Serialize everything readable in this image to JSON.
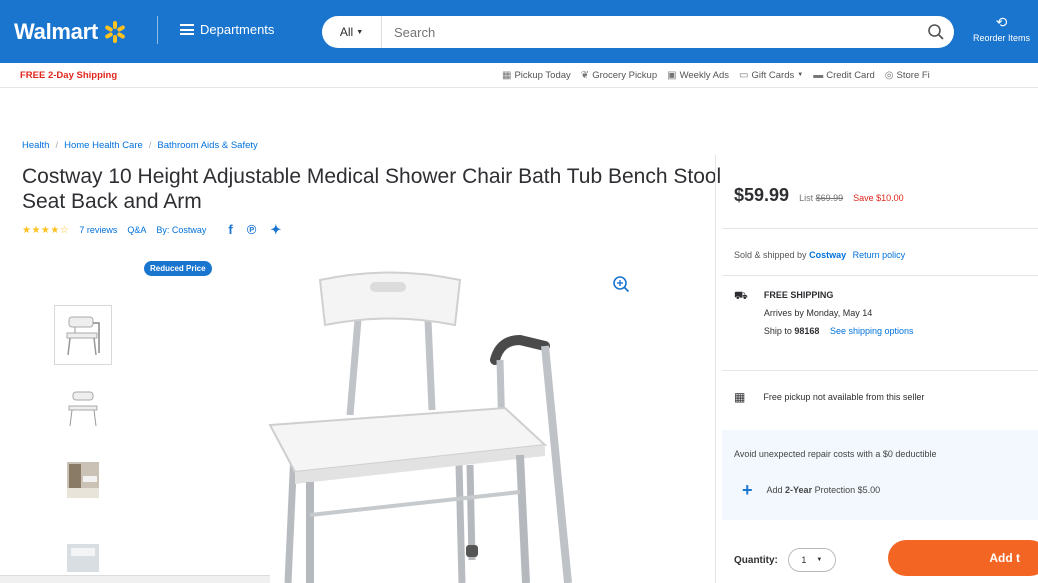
{
  "header": {
    "logo_text": "Walmart",
    "departments_label": "Departments",
    "search_category": "All",
    "search_placeholder": "Search",
    "reorder_label": "Reorder Items"
  },
  "subheader": {
    "free_shipping": "FREE 2-Day Shipping",
    "links": [
      "Pickup Today",
      "Grocery Pickup",
      "Weekly Ads",
      "Gift Cards",
      "Credit Card",
      "Store Fi"
    ]
  },
  "breadcrumb": [
    "Health",
    "Home Health Care",
    "Bathroom Aids & Safety"
  ],
  "product": {
    "title": "Costway 10 Height Adjustable Medical Shower Chair Bath Tub Bench Stool Seat Back and Arm",
    "rating_stars": "★★★★☆",
    "reviews": "7 reviews",
    "qa": "Q&A",
    "brand": "By: Costway",
    "badge": "Reduced Price"
  },
  "offer": {
    "price": "$59.99",
    "list_price_label": "List",
    "list_price": "$69.99",
    "save_text": "Save $10.00",
    "sold_by_prefix": "Sold & shipped by",
    "seller": "Costway",
    "return_policy": "Return policy",
    "shipping_title": "FREE SHIPPING",
    "arrives": "Arrives by Monday, May 14",
    "ship_to_prefix": "Ship to",
    "ship_to_zip": "98168",
    "shipping_options": "See shipping options",
    "pickup_text": "Free pickup not available from this seller",
    "protection_text": "Avoid unexpected repair costs with a $0 deductible",
    "protection_add_prefix": "Add",
    "protection_plan": "2-Year",
    "protection_suffix": "Protection $5.00",
    "quantity_label": "Quantity:",
    "quantity_value": "1",
    "add_button": "Add t"
  },
  "colors": {
    "brand_blue": "#1a75cf",
    "spark": "#ffc220",
    "sale_red": "#e0261c",
    "add_orange": "#f26522"
  }
}
